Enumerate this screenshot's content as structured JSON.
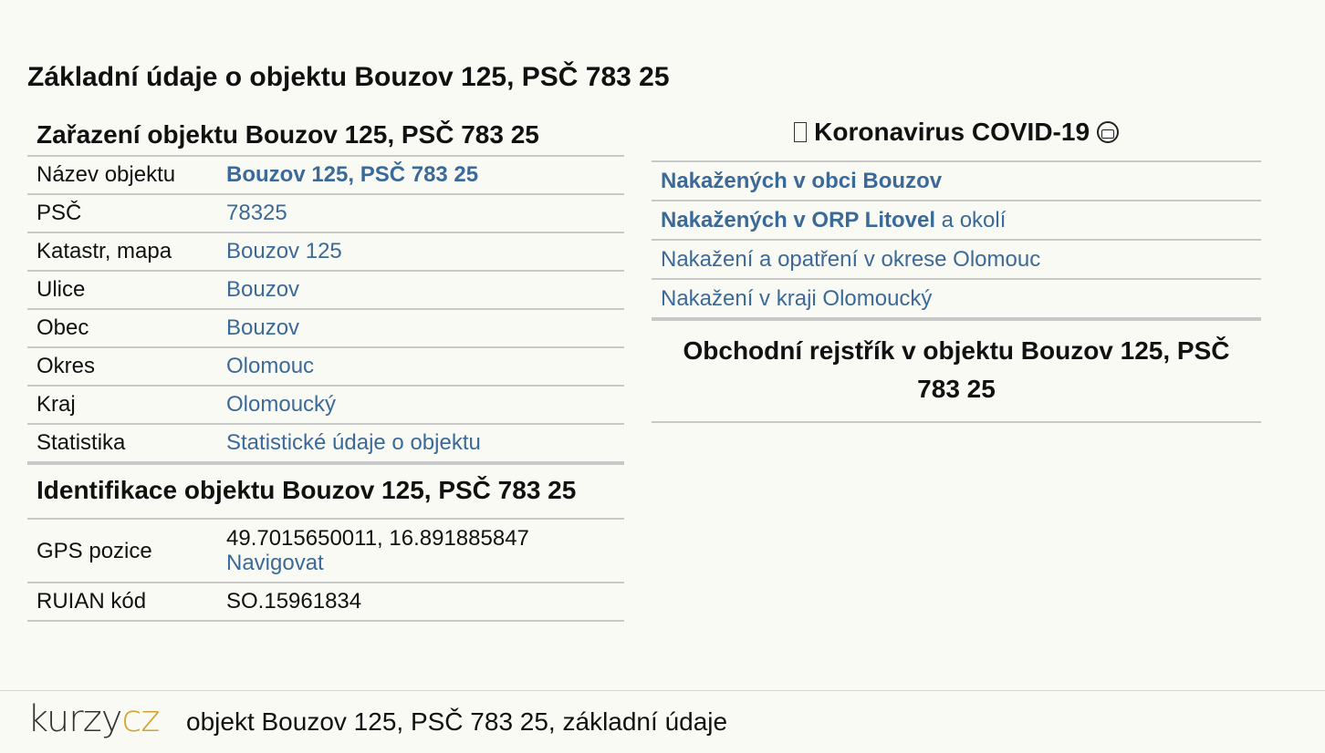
{
  "page_title": "Základní údaje o objektu Bouzov 125, PSČ 783 25",
  "zarazeni": {
    "heading": "Zařazení objektu Bouzov 125, PSČ 783 25",
    "rows": [
      {
        "label": "Název objektu",
        "value": "Bouzov 125, PSČ 783 25"
      },
      {
        "label": "PSČ",
        "value": "78325"
      },
      {
        "label": "Katastr, mapa",
        "value": "Bouzov 125"
      },
      {
        "label": "Ulice",
        "value": "Bouzov"
      },
      {
        "label": "Obec",
        "value": "Bouzov"
      },
      {
        "label": "Okres",
        "value": "Olomouc"
      },
      {
        "label": "Kraj",
        "value": "Olomoucký"
      },
      {
        "label": "Statistika",
        "value": "Statistické údaje o objektu"
      }
    ]
  },
  "identifikace": {
    "heading": "Identifikace objektu Bouzov 125, PSČ 783 25",
    "gps_label": "GPS pozice",
    "gps_value": "49.7015650011, 16.891885847",
    "gps_link": "Navigovat",
    "ruian_label": "RUIAN kód",
    "ruian_value": "SO.15961834"
  },
  "covid": {
    "heading": "Koronavirus COVID-19",
    "links": {
      "obec": "Nakažených v obci Bouzov",
      "orp": "Nakažených v ORP Litovel",
      "orp_suffix": " a okolí",
      "okres": "Nakažení a opatření v okrese Olomouc",
      "kraj": "Nakažení v kraji Olomoucký"
    }
  },
  "obchodni_rejstrik": {
    "heading": "Obchodní rejstřík v objektu Bouzov 125, PSČ 783 25"
  },
  "footer": {
    "logo_part1": "kurzy",
    "logo_part2": "cz",
    "text": "objekt Bouzov 125, PSČ 783 25, základní údaje"
  }
}
